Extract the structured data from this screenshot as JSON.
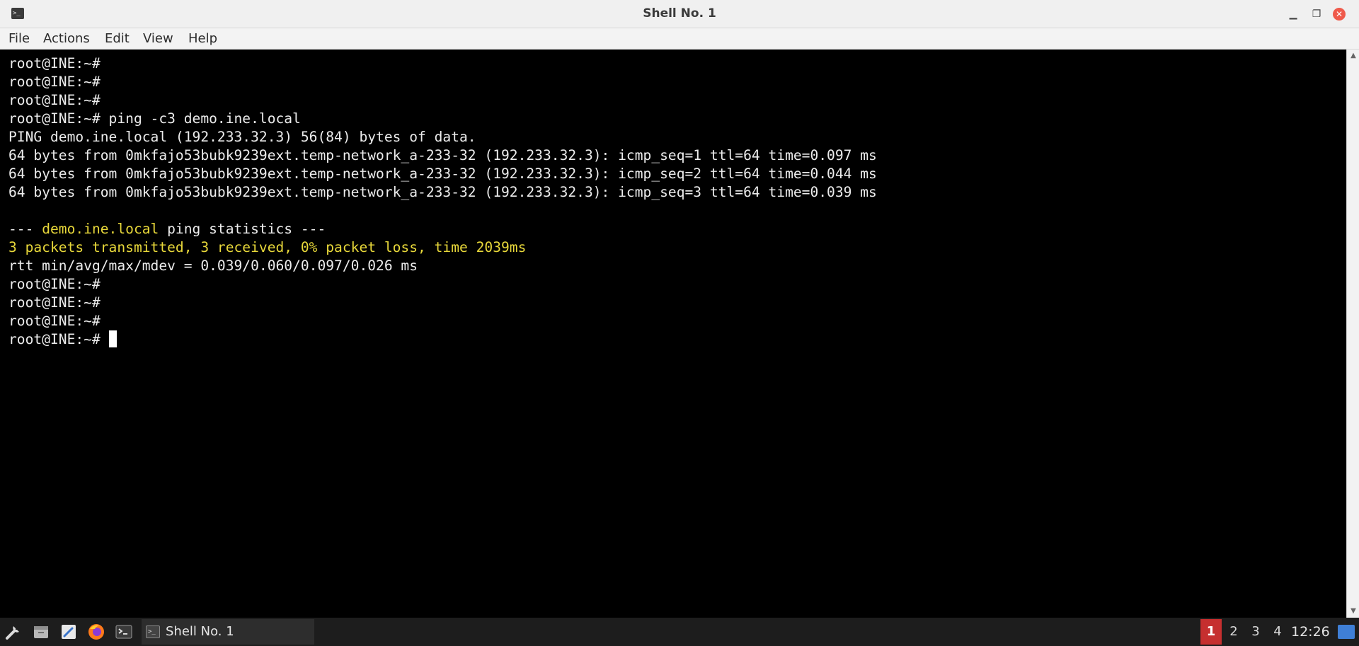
{
  "window": {
    "title": "Shell No. 1",
    "app_icon_glyph": ">_"
  },
  "menu": {
    "items": [
      "File",
      "Actions",
      "Edit",
      "View",
      "Help"
    ]
  },
  "terminal": {
    "lines": [
      "root@INE:~#",
      "root@INE:~#",
      "root@INE:~#",
      "root@INE:~# ping -c3 demo.ine.local",
      "PING demo.ine.local (192.233.32.3) 56(84) bytes of data.",
      "64 bytes from 0mkfajo53bubk9239ext.temp-network_a-233-32 (192.233.32.3): icmp_seq=1 ttl=64 time=0.097 ms",
      "64 bytes from 0mkfajo53bubk9239ext.temp-network_a-233-32 (192.233.32.3): icmp_seq=2 ttl=64 time=0.044 ms",
      "64 bytes from 0mkfajo53bubk9239ext.temp-network_a-233-32 (192.233.32.3): icmp_seq=3 ttl=64 time=0.039 ms",
      "",
      {
        "prefix": "--- ",
        "highlight": "demo.ine.local",
        "suffix": " ping statistics ---"
      },
      {
        "highlight": "3 packets transmitted, 3 received, 0% packet loss, time 2039ms"
      },
      "rtt min/avg/max/mdev = 0.039/0.060/0.097/0.026 ms",
      "root@INE:~#",
      "root@INE:~#",
      "root@INE:~#",
      "root@INE:~# "
    ],
    "highlight_color": "#e8d83a",
    "text_color": "#ececec"
  },
  "taskbar": {
    "launchers": [
      "settings-icon",
      "file-manager-icon",
      "text-editor-icon",
      "firefox-icon",
      "terminal-icon"
    ],
    "task": {
      "label": "Shell No. 1",
      "icon_glyph": ">_"
    },
    "workspaces": [
      "1",
      "2",
      "3",
      "4"
    ],
    "active_workspace": "1",
    "clock": "12:26"
  },
  "colors": {
    "active_workspace": "#c62f2f",
    "close_button": "#ef5a4b",
    "show_desktop": "#3f7fd6"
  }
}
